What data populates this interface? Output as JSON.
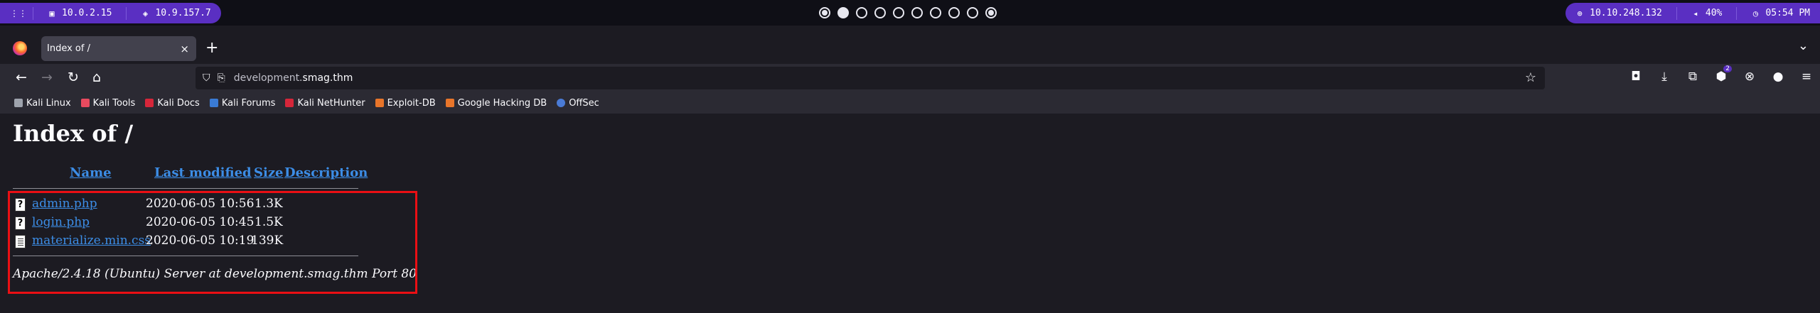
{
  "system_bar": {
    "left_items": [
      {
        "icon": "menu-grid-icon",
        "text": ""
      },
      {
        "icon": "monitor-icon",
        "text": "10.0.2.15"
      },
      {
        "icon": "vpn-shield-icon",
        "text": "10.9.157.7"
      }
    ],
    "workspaces": [
      {
        "state": "active"
      },
      {
        "state": "current"
      },
      {
        "state": "empty"
      },
      {
        "state": "empty"
      },
      {
        "state": "empty"
      },
      {
        "state": "empty"
      },
      {
        "state": "empty"
      },
      {
        "state": "empty"
      },
      {
        "state": "empty"
      },
      {
        "state": "active"
      }
    ],
    "right_items": [
      {
        "icon": "target-icon",
        "text": "10.10.248.132"
      },
      {
        "icon": "volume-icon",
        "text": "40%"
      },
      {
        "icon": "clock-icon",
        "text": "05:54 PM"
      }
    ]
  },
  "browser": {
    "tab": {
      "title": "Index of /",
      "close_glyph": "×"
    },
    "new_tab_glyph": "+",
    "tab_list_glyph": "⌄",
    "url": {
      "host_prefix": "development.",
      "host_main": "smag.thm"
    },
    "bookmarks": [
      {
        "label": "Kali Linux",
        "color": "#9ea3ad"
      },
      {
        "label": "Kali Tools",
        "color": "#e84a5f"
      },
      {
        "label": "Kali Docs",
        "color": "#d6263a"
      },
      {
        "label": "Kali Forums",
        "color": "#3a7bd5"
      },
      {
        "label": "Kali NetHunter",
        "color": "#d6263a"
      },
      {
        "label": "Exploit-DB",
        "color": "#e8752a"
      },
      {
        "label": "Google Hacking DB",
        "color": "#e8752a"
      },
      {
        "label": "OffSec",
        "color": "#4a7bd6"
      }
    ]
  },
  "page": {
    "title": "Index of /",
    "headers": {
      "name": "Name",
      "modified": "Last modified",
      "size": "Size",
      "description": "Description"
    },
    "files": [
      {
        "name": "admin.php",
        "modified": "2020-06-05 10:56",
        "size": "1.3K",
        "icon": "unknown-file-icon"
      },
      {
        "name": "login.php",
        "modified": "2020-06-05 10:45",
        "size": "1.5K",
        "icon": "unknown-file-icon"
      },
      {
        "name": "materialize.min.css",
        "modified": "2020-06-05 10:19",
        "size": "139K",
        "icon": "text-file-icon"
      }
    ],
    "address": "Apache/2.4.18 (Ubuntu) Server at development.smag.thm Port 80"
  },
  "colors": {
    "accent": "#5a2fc2",
    "link": "#3c8de6",
    "highlight": "#ea0f14"
  }
}
